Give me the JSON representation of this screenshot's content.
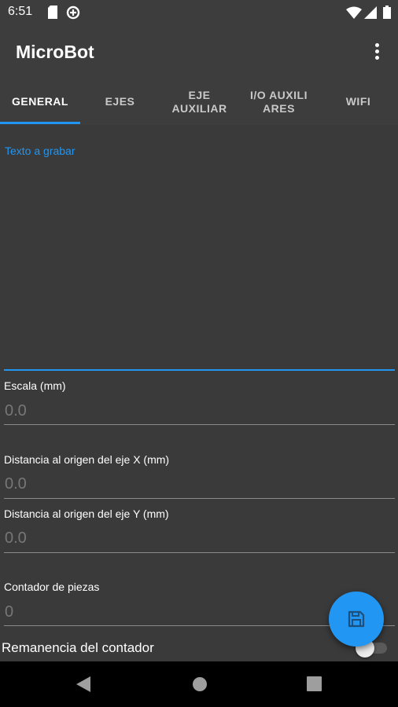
{
  "status_bar": {
    "time": "6:51",
    "left_icons": [
      "sim-card-icon",
      "data-saver-icon"
    ],
    "right_icons": [
      "wifi-icon",
      "cellular-signal-icon",
      "battery-icon"
    ]
  },
  "app_bar": {
    "title": "MicroBot",
    "menu_icon": "more-vertical-icon"
  },
  "tabs": [
    {
      "label": "GENERAL",
      "active": true
    },
    {
      "label": "EJES",
      "active": false
    },
    {
      "label": "EJE\nAUXILIAR",
      "active": false
    },
    {
      "label": "I/O AUXILI\nARES",
      "active": false
    },
    {
      "label": "WIFI",
      "active": false
    }
  ],
  "form": {
    "text_to_engrave": {
      "label": "Texto a grabar",
      "value": ""
    },
    "scale": {
      "label": "Escala (mm)",
      "placeholder": "0.0"
    },
    "distance_x": {
      "label": "Distancia al origen del eje X (mm)",
      "placeholder": "0.0"
    },
    "distance_y": {
      "label": "Distancia al origen del eje Y (mm)",
      "placeholder": "0.0"
    },
    "piece_counter": {
      "label": "Contador de piezas",
      "placeholder": "0"
    },
    "counter_retention": {
      "label": "Remanencia del contador",
      "checked": false
    }
  },
  "fab": {
    "icon": "save-icon"
  },
  "nav_bar": {
    "icons": [
      "back-icon",
      "home-icon",
      "recents-icon"
    ]
  },
  "colors": {
    "accent": "#2196f3",
    "background": "#3a3a3a",
    "toolbar": "#3d3d3d",
    "nav_bar": "#000000"
  }
}
